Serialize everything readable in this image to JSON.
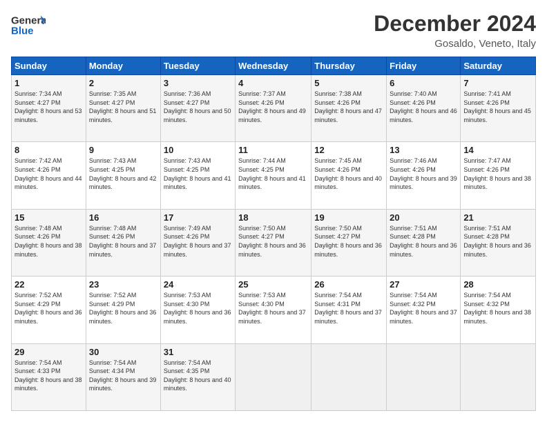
{
  "header": {
    "logo_general": "General",
    "logo_blue": "Blue",
    "title": "December 2024",
    "location": "Gosaldo, Veneto, Italy"
  },
  "days_of_week": [
    "Sunday",
    "Monday",
    "Tuesday",
    "Wednesday",
    "Thursday",
    "Friday",
    "Saturday"
  ],
  "weeks": [
    [
      {
        "day": "1",
        "sunrise": "Sunrise: 7:34 AM",
        "sunset": "Sunset: 4:27 PM",
        "daylight": "Daylight: 8 hours and 53 minutes."
      },
      {
        "day": "2",
        "sunrise": "Sunrise: 7:35 AM",
        "sunset": "Sunset: 4:27 PM",
        "daylight": "Daylight: 8 hours and 51 minutes."
      },
      {
        "day": "3",
        "sunrise": "Sunrise: 7:36 AM",
        "sunset": "Sunset: 4:27 PM",
        "daylight": "Daylight: 8 hours and 50 minutes."
      },
      {
        "day": "4",
        "sunrise": "Sunrise: 7:37 AM",
        "sunset": "Sunset: 4:26 PM",
        "daylight": "Daylight: 8 hours and 49 minutes."
      },
      {
        "day": "5",
        "sunrise": "Sunrise: 7:38 AM",
        "sunset": "Sunset: 4:26 PM",
        "daylight": "Daylight: 8 hours and 47 minutes."
      },
      {
        "day": "6",
        "sunrise": "Sunrise: 7:40 AM",
        "sunset": "Sunset: 4:26 PM",
        "daylight": "Daylight: 8 hours and 46 minutes."
      },
      {
        "day": "7",
        "sunrise": "Sunrise: 7:41 AM",
        "sunset": "Sunset: 4:26 PM",
        "daylight": "Daylight: 8 hours and 45 minutes."
      }
    ],
    [
      {
        "day": "8",
        "sunrise": "Sunrise: 7:42 AM",
        "sunset": "Sunset: 4:26 PM",
        "daylight": "Daylight: 8 hours and 44 minutes."
      },
      {
        "day": "9",
        "sunrise": "Sunrise: 7:43 AM",
        "sunset": "Sunset: 4:25 PM",
        "daylight": "Daylight: 8 hours and 42 minutes."
      },
      {
        "day": "10",
        "sunrise": "Sunrise: 7:43 AM",
        "sunset": "Sunset: 4:25 PM",
        "daylight": "Daylight: 8 hours and 41 minutes."
      },
      {
        "day": "11",
        "sunrise": "Sunrise: 7:44 AM",
        "sunset": "Sunset: 4:25 PM",
        "daylight": "Daylight: 8 hours and 41 minutes."
      },
      {
        "day": "12",
        "sunrise": "Sunrise: 7:45 AM",
        "sunset": "Sunset: 4:26 PM",
        "daylight": "Daylight: 8 hours and 40 minutes."
      },
      {
        "day": "13",
        "sunrise": "Sunrise: 7:46 AM",
        "sunset": "Sunset: 4:26 PM",
        "daylight": "Daylight: 8 hours and 39 minutes."
      },
      {
        "day": "14",
        "sunrise": "Sunrise: 7:47 AM",
        "sunset": "Sunset: 4:26 PM",
        "daylight": "Daylight: 8 hours and 38 minutes."
      }
    ],
    [
      {
        "day": "15",
        "sunrise": "Sunrise: 7:48 AM",
        "sunset": "Sunset: 4:26 PM",
        "daylight": "Daylight: 8 hours and 38 minutes."
      },
      {
        "day": "16",
        "sunrise": "Sunrise: 7:48 AM",
        "sunset": "Sunset: 4:26 PM",
        "daylight": "Daylight: 8 hours and 37 minutes."
      },
      {
        "day": "17",
        "sunrise": "Sunrise: 7:49 AM",
        "sunset": "Sunset: 4:26 PM",
        "daylight": "Daylight: 8 hours and 37 minutes."
      },
      {
        "day": "18",
        "sunrise": "Sunrise: 7:50 AM",
        "sunset": "Sunset: 4:27 PM",
        "daylight": "Daylight: 8 hours and 36 minutes."
      },
      {
        "day": "19",
        "sunrise": "Sunrise: 7:50 AM",
        "sunset": "Sunset: 4:27 PM",
        "daylight": "Daylight: 8 hours and 36 minutes."
      },
      {
        "day": "20",
        "sunrise": "Sunrise: 7:51 AM",
        "sunset": "Sunset: 4:28 PM",
        "daylight": "Daylight: 8 hours and 36 minutes."
      },
      {
        "day": "21",
        "sunrise": "Sunrise: 7:51 AM",
        "sunset": "Sunset: 4:28 PM",
        "daylight": "Daylight: 8 hours and 36 minutes."
      }
    ],
    [
      {
        "day": "22",
        "sunrise": "Sunrise: 7:52 AM",
        "sunset": "Sunset: 4:29 PM",
        "daylight": "Daylight: 8 hours and 36 minutes."
      },
      {
        "day": "23",
        "sunrise": "Sunrise: 7:52 AM",
        "sunset": "Sunset: 4:29 PM",
        "daylight": "Daylight: 8 hours and 36 minutes."
      },
      {
        "day": "24",
        "sunrise": "Sunrise: 7:53 AM",
        "sunset": "Sunset: 4:30 PM",
        "daylight": "Daylight: 8 hours and 36 minutes."
      },
      {
        "day": "25",
        "sunrise": "Sunrise: 7:53 AM",
        "sunset": "Sunset: 4:30 PM",
        "daylight": "Daylight: 8 hours and 37 minutes."
      },
      {
        "day": "26",
        "sunrise": "Sunrise: 7:54 AM",
        "sunset": "Sunset: 4:31 PM",
        "daylight": "Daylight: 8 hours and 37 minutes."
      },
      {
        "day": "27",
        "sunrise": "Sunrise: 7:54 AM",
        "sunset": "Sunset: 4:32 PM",
        "daylight": "Daylight: 8 hours and 37 minutes."
      },
      {
        "day": "28",
        "sunrise": "Sunrise: 7:54 AM",
        "sunset": "Sunset: 4:32 PM",
        "daylight": "Daylight: 8 hours and 38 minutes."
      }
    ],
    [
      {
        "day": "29",
        "sunrise": "Sunrise: 7:54 AM",
        "sunset": "Sunset: 4:33 PM",
        "daylight": "Daylight: 8 hours and 38 minutes."
      },
      {
        "day": "30",
        "sunrise": "Sunrise: 7:54 AM",
        "sunset": "Sunset: 4:34 PM",
        "daylight": "Daylight: 8 hours and 39 minutes."
      },
      {
        "day": "31",
        "sunrise": "Sunrise: 7:54 AM",
        "sunset": "Sunset: 4:35 PM",
        "daylight": "Daylight: 8 hours and 40 minutes."
      },
      null,
      null,
      null,
      null
    ]
  ]
}
